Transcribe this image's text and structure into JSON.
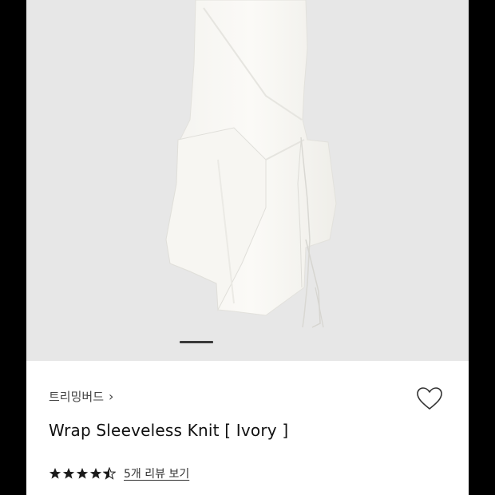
{
  "product_image": {
    "description_icon": "product-photo",
    "active_slide": 1,
    "background": "#e7e7e7"
  },
  "product": {
    "brand": "트리밍버드",
    "brand_chevron": "›",
    "title": "Wrap Sleeveless Knit [ Ivory ]"
  },
  "rating": {
    "stars": 4.5,
    "review_link": "5개 리뷰 보기"
  },
  "icons": {
    "wishlist": "heart-outline-icon",
    "chevron": "chevron-right-icon",
    "star": "star-icon"
  },
  "colors": {
    "text_primary": "#111111",
    "text_secondary": "#444444",
    "star": "#1a1a1a"
  }
}
